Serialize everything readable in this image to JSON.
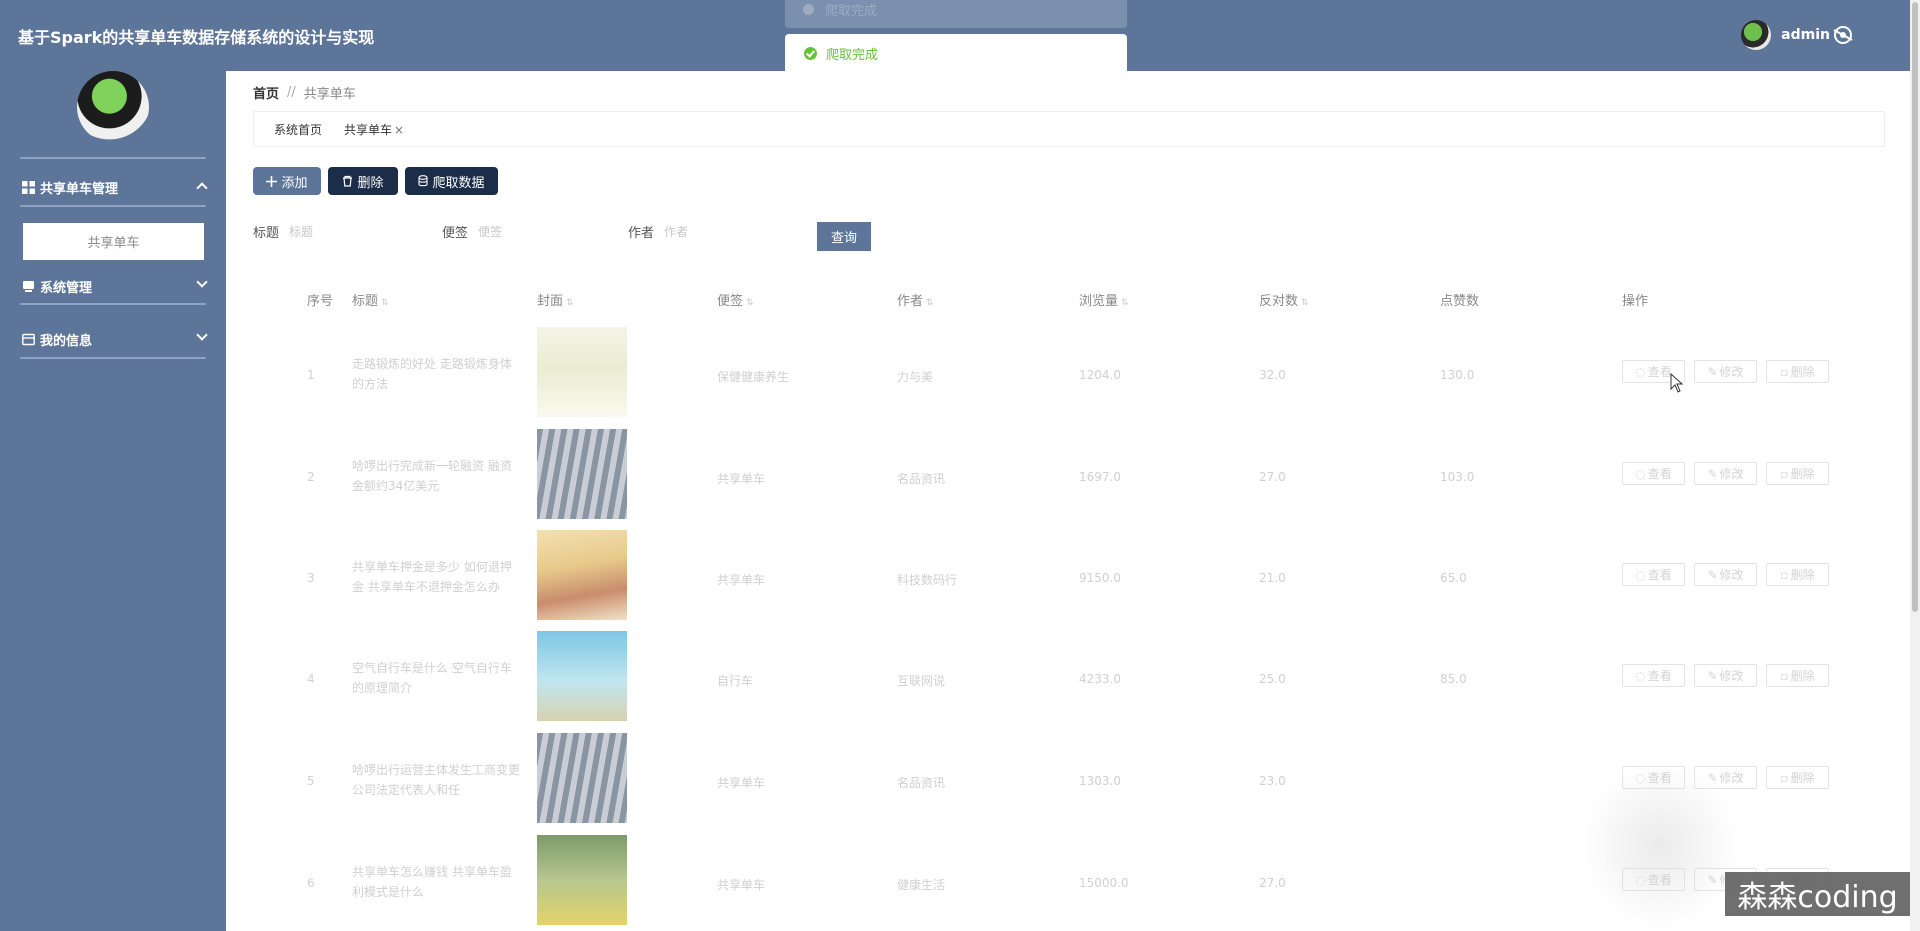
{
  "header": {
    "title": "基于Spark的共享单车数据存储系统的设计与实现",
    "username": "admin"
  },
  "toast": {
    "ghost_text": "爬取完成",
    "message": "爬取完成"
  },
  "sidebar": {
    "menus": [
      {
        "label": "共享单车管理",
        "icon": "grid-icon",
        "expanded": true,
        "children": [
          "共享单车"
        ]
      },
      {
        "label": "系统管理",
        "icon": "monitor-icon",
        "expanded": false
      },
      {
        "label": "我的信息",
        "icon": "card-icon",
        "expanded": false
      }
    ]
  },
  "breadcrumb": {
    "home": "首页",
    "separator": "//",
    "current": "共享单车"
  },
  "tags": [
    {
      "label": "系统首页"
    },
    {
      "label": "共享单车",
      "close": "×"
    }
  ],
  "toolbar": {
    "add": "添加",
    "delete": "删除",
    "crawl": "爬取数据"
  },
  "search": {
    "title_label": "标题",
    "title_placeholder": "标题",
    "note_label": "便签",
    "note_placeholder": "便签",
    "author_label": "作者",
    "author_placeholder": "作者",
    "submit": "查询"
  },
  "table": {
    "headers": [
      "序号",
      "标题",
      "封面",
      "便签",
      "作者",
      "浏览量",
      "反对数",
      "点赞数",
      "操作"
    ],
    "actions": {
      "view": "查看",
      "edit": "修改",
      "delete": "删除"
    },
    "rows": [
      {
        "no": "1",
        "title": "走路锻炼的好处 走路锻炼身体的方法",
        "note": "保健健康养生",
        "author": "力与美",
        "views": "1204.0",
        "oppose": "32.0",
        "likes": "130.0"
      },
      {
        "no": "2",
        "title": "哈啰出行完成新一轮融资 融资金额约34亿美元",
        "note": "共享单车",
        "author": "名品资讯",
        "views": "1697.0",
        "oppose": "27.0",
        "likes": "103.0"
      },
      {
        "no": "3",
        "title": "共享单车押金是多少 如何退押金 共享单车不退押金怎么办",
        "note": "共享单车",
        "author": "科技数码行",
        "views": "9150.0",
        "oppose": "21.0",
        "likes": "65.0"
      },
      {
        "no": "4",
        "title": "空气自行车是什么 空气自行车的原理简介",
        "note": "自行车",
        "author": "互联网说",
        "views": "4233.0",
        "oppose": "25.0",
        "likes": "85.0"
      },
      {
        "no": "5",
        "title": "哈啰出行运营主体发生工商变更 公司法定代表人和任",
        "note": "共享单车",
        "author": "名品资讯",
        "views": "1303.0",
        "oppose": "23.0",
        "likes": ""
      },
      {
        "no": "6",
        "title": "共享单车怎么赚钱 共享单车盈利模式是什么",
        "note": "共享单车",
        "author": "健康生活",
        "views": "15000.0",
        "oppose": "27.0",
        "likes": ""
      }
    ]
  },
  "watermark": "森森coding"
}
